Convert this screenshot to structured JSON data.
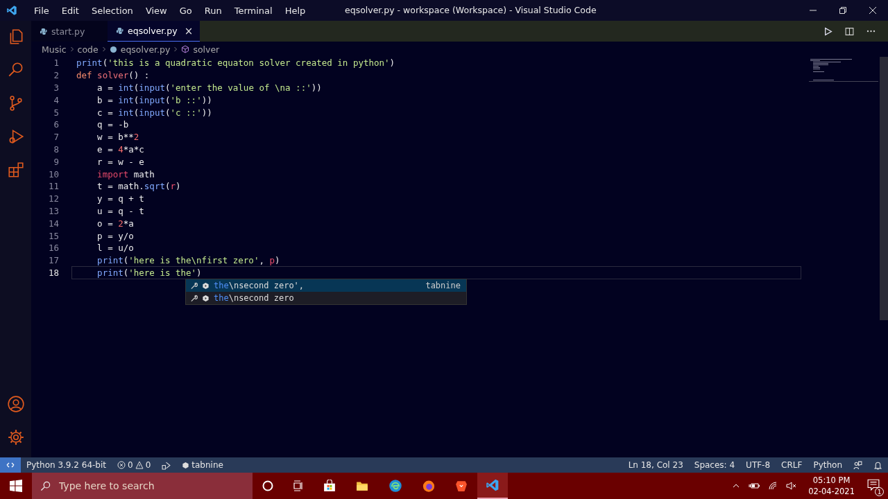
{
  "window": {
    "title": "eqsolver.py - workspace (Workspace) - Visual Studio Code"
  },
  "menu": [
    "File",
    "Edit",
    "Selection",
    "View",
    "Go",
    "Run",
    "Terminal",
    "Help"
  ],
  "tabs": [
    {
      "label": "start.py",
      "selected": false
    },
    {
      "label": "eqsolver.py",
      "selected": true,
      "close": "×"
    }
  ],
  "breadcrumb": [
    "Music",
    "code",
    "eqsolver.py",
    "solver"
  ],
  "lines": [
    {
      "number": "1",
      "current": false,
      "tokens": [
        {
          "kind": "call",
          "text": "print"
        },
        {
          "kind": "plain",
          "text": "("
        },
        {
          "kind": "str",
          "text": "'this is a quadratic equaton solver created in python'"
        },
        {
          "kind": "plain",
          "text": ")"
        }
      ]
    },
    {
      "number": "2",
      "current": false,
      "tokens": [
        {
          "kind": "kw",
          "text": "def "
        },
        {
          "kind": "fname",
          "text": "solver"
        },
        {
          "kind": "plain",
          "text": "() :"
        }
      ]
    },
    {
      "number": "3",
      "current": false,
      "tokens": [
        {
          "kind": "plain",
          "text": "    a = "
        },
        {
          "kind": "call",
          "text": "int"
        },
        {
          "kind": "plain",
          "text": "("
        },
        {
          "kind": "call",
          "text": "input"
        },
        {
          "kind": "plain",
          "text": "("
        },
        {
          "kind": "str",
          "text": "'enter the value of \\na ::'"
        },
        {
          "kind": "plain",
          "text": "))"
        }
      ]
    },
    {
      "number": "4",
      "current": false,
      "tokens": [
        {
          "kind": "plain",
          "text": "    b = "
        },
        {
          "kind": "call",
          "text": "int"
        },
        {
          "kind": "plain",
          "text": "("
        },
        {
          "kind": "call",
          "text": "input"
        },
        {
          "kind": "plain",
          "text": "("
        },
        {
          "kind": "str",
          "text": "'b ::'"
        },
        {
          "kind": "plain",
          "text": "))"
        }
      ]
    },
    {
      "number": "5",
      "current": false,
      "tokens": [
        {
          "kind": "plain",
          "text": "    c = "
        },
        {
          "kind": "call",
          "text": "int"
        },
        {
          "kind": "plain",
          "text": "("
        },
        {
          "kind": "call",
          "text": "input"
        },
        {
          "kind": "plain",
          "text": "("
        },
        {
          "kind": "str",
          "text": "'c ::'"
        },
        {
          "kind": "plain",
          "text": "))"
        }
      ]
    },
    {
      "number": "6",
      "current": false,
      "tokens": [
        {
          "kind": "plain",
          "text": "    q = -b"
        }
      ]
    },
    {
      "number": "7",
      "current": false,
      "tokens": [
        {
          "kind": "plain",
          "text": "    w = b**"
        },
        {
          "kind": "num",
          "text": "2"
        }
      ]
    },
    {
      "number": "8",
      "current": false,
      "tokens": [
        {
          "kind": "plain",
          "text": "    e = "
        },
        {
          "kind": "num",
          "text": "4"
        },
        {
          "kind": "plain",
          "text": "*a*c"
        }
      ]
    },
    {
      "number": "9",
      "current": false,
      "tokens": [
        {
          "kind": "plain",
          "text": "    r = w - e"
        }
      ]
    },
    {
      "number": "10",
      "current": false,
      "tokens": [
        {
          "kind": "import",
          "text": "    import"
        },
        {
          "kind": "plain",
          "text": " math"
        }
      ]
    },
    {
      "number": "11",
      "current": false,
      "tokens": [
        {
          "kind": "plain",
          "text": "    t = math."
        },
        {
          "kind": "call",
          "text": "sqrt"
        },
        {
          "kind": "plain",
          "text": "("
        },
        {
          "kind": "arg",
          "text": "r"
        },
        {
          "kind": "plain",
          "text": ")"
        }
      ]
    },
    {
      "number": "12",
      "current": false,
      "tokens": [
        {
          "kind": "plain",
          "text": "    y = q + t"
        }
      ]
    },
    {
      "number": "13",
      "current": false,
      "tokens": [
        {
          "kind": "plain",
          "text": "    u = q - t"
        }
      ]
    },
    {
      "number": "14",
      "current": false,
      "tokens": [
        {
          "kind": "plain",
          "text": "    o = "
        },
        {
          "kind": "num",
          "text": "2"
        },
        {
          "kind": "plain",
          "text": "*a"
        }
      ]
    },
    {
      "number": "15",
      "current": false,
      "tokens": [
        {
          "kind": "plain",
          "text": "    p = y/o"
        }
      ]
    },
    {
      "number": "16",
      "current": false,
      "tokens": [
        {
          "kind": "plain",
          "text": "    l = u/o"
        }
      ]
    },
    {
      "number": "17",
      "current": false,
      "tokens": [
        {
          "kind": "call",
          "text": "    print"
        },
        {
          "kind": "plain",
          "text": "("
        },
        {
          "kind": "str",
          "text": "'here is the\\nfirst zero'"
        },
        {
          "kind": "plain",
          "text": ", "
        },
        {
          "kind": "arg",
          "text": "p"
        },
        {
          "kind": "plain",
          "text": ")"
        }
      ]
    },
    {
      "number": "18",
      "current": true,
      "tokens": [
        {
          "kind": "call",
          "text": "    print"
        },
        {
          "kind": "plain",
          "text": "("
        },
        {
          "kind": "str",
          "text": "'here is the'"
        },
        {
          "kind": "plain",
          "text": ")"
        }
      ]
    }
  ],
  "suggestions": [
    {
      "match": "the",
      "rest": "\\nsecond zero',",
      "detail": "tabnine",
      "selected": true
    },
    {
      "match": "the",
      "rest": "\\nsecond zero",
      "selected": false
    }
  ],
  "status_bar": {
    "interpreter": "Python 3.9.2 64-bit",
    "errors": "0",
    "warnings": "0",
    "tabnine": "tabnine",
    "position": "Ln 18, Col 23",
    "spaces": "Spaces: 4",
    "encoding": "UTF-8",
    "eol": "CRLF",
    "language": "Python"
  },
  "taskbar": {
    "search_placeholder": "Type here to search",
    "time": "05:10 PM",
    "date": "02-04-2021",
    "notifications": "1"
  }
}
